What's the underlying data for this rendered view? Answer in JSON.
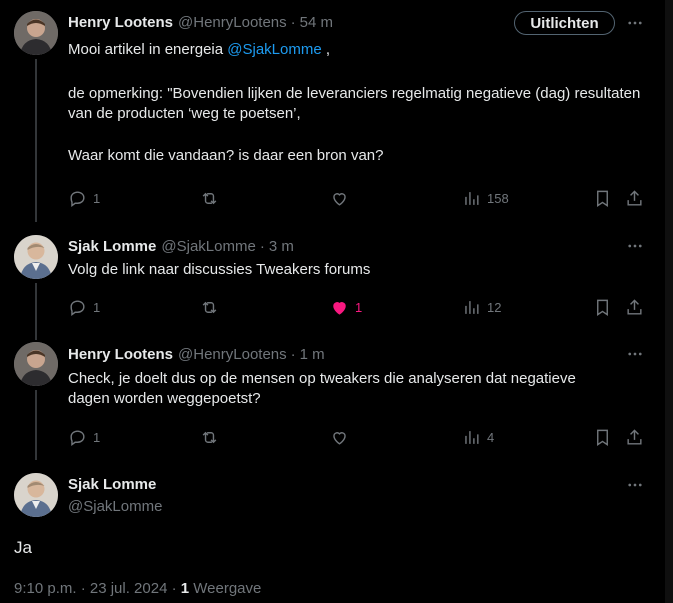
{
  "tweets": [
    {
      "name": "Henry Lootens",
      "handle": "@HenryLootens",
      "time": "54 m",
      "follow_label": "Uitlichten",
      "text_before_mention": "Mooi artikel in energeia ",
      "mention": "@SjakLomme",
      "text_after_mention": " ,",
      "paragraphs": [
        "de opmerking: \"Bovendien lijken de leveranciers regelmatig negatieve (dag) resultaten van de producten ‘weg te poetsen’,",
        "Waar komt die vandaan? is daar een bron van?"
      ],
      "replies": "1",
      "views": "158"
    },
    {
      "name": "Sjak Lomme",
      "handle": "@SjakLomme",
      "time": "3 m",
      "paragraphs": [
        "Volg de link naar discussies Tweakers forums"
      ],
      "replies": "1",
      "likes": "1",
      "views": "12"
    },
    {
      "name": "Henry Lootens",
      "handle": "@HenryLootens",
      "time": "1 m",
      "paragraphs": [
        "Check, je doelt dus op de mensen op tweakers die analyseren dat negatieve dagen worden weggepoetst?"
      ],
      "replies": "1",
      "views": "4"
    }
  ],
  "focus": {
    "name": "Sjak Lomme",
    "handle": "@SjakLomme",
    "text": "Ja",
    "timestamp": "9:10 p.m. · 23 jul. 2024 · ",
    "view_count": "1",
    "view_label": " Weergave"
  },
  "separator": "·",
  "icons": {
    "reply": "reply-icon",
    "retweet": "retweet-icon",
    "like": "like-icon",
    "views": "views-icon",
    "bookmark": "bookmark-icon",
    "share": "share-icon",
    "more": "more-icon"
  },
  "colors": {
    "background": "#000000",
    "text": "#e7e9ea",
    "secondary": "#71767b",
    "link": "#1d9bf0",
    "like": "#f91880"
  }
}
